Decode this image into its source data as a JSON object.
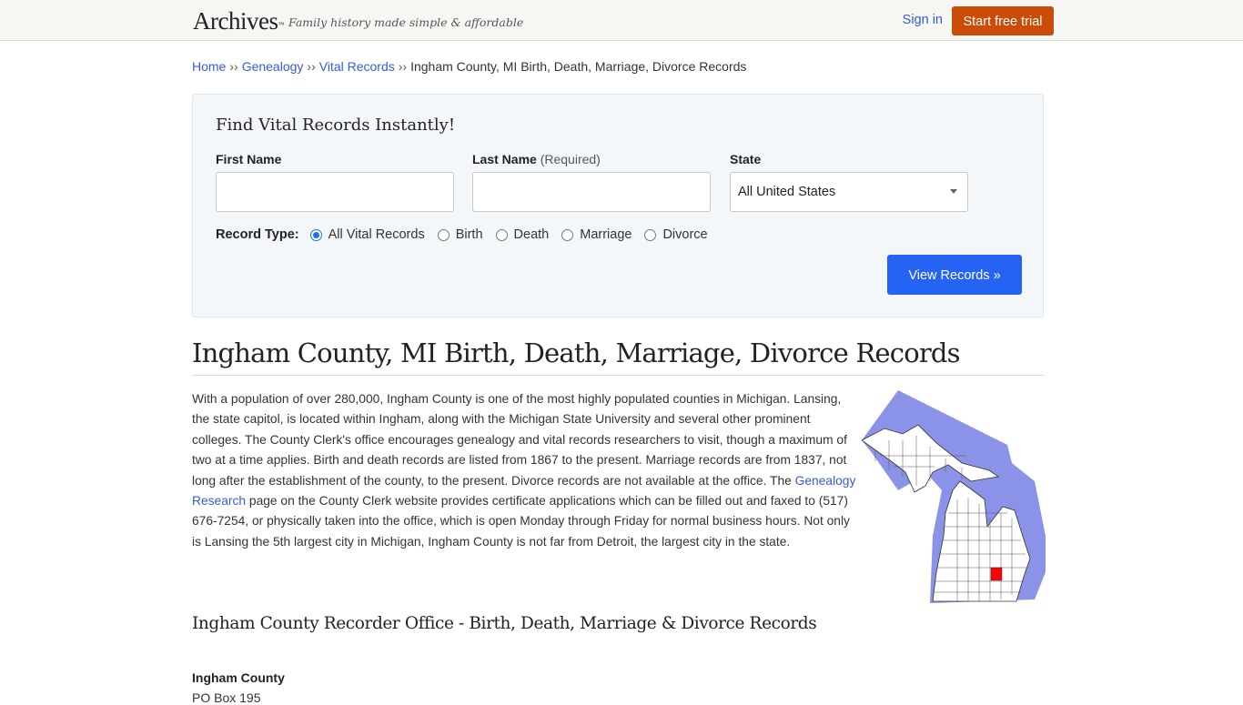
{
  "header": {
    "logo": "Archives",
    "logo_mark": "™",
    "tagline": "Family history made simple & affordable",
    "sign_in": "Sign in",
    "start_trial": "Start free trial"
  },
  "breadcrumb": {
    "items": [
      "Home",
      "Genealogy",
      "Vital Records"
    ],
    "separator": "››",
    "current": "Ingham County, MI Birth, Death, Marriage, Divorce Records"
  },
  "search": {
    "title": "Find Vital Records Instantly!",
    "first_name_label": "First Name",
    "first_name_value": "",
    "last_name_label": "Last Name",
    "last_name_required": "(Required)",
    "last_name_value": "",
    "state_label": "State",
    "state_value": "All United States",
    "record_type_label": "Record Type:",
    "record_types": [
      "All Vital Records",
      "Birth",
      "Death",
      "Marriage",
      "Divorce"
    ],
    "record_type_selected": "All Vital Records",
    "submit": "View Records »"
  },
  "main": {
    "title": "Ingham County, MI Birth, Death, Marriage, Divorce Records",
    "intro_part1": "With a population of over 280,000, Ingham County is one of the most highly populated counties in Michigan. Lansing, the state capitol, is located within Ingham, along with the Michigan State University and several other prominent colleges. The County Clerk's office encourages genealogy and vital records researchers to visit, though a maximum of two at a time applies. Birth and death records are listed from 1867 to the present. Marriage records are from 1837, not long after the establishment of the county, to the present. Divorce records are not available at the office. The ",
    "intro_link": "Genealogy Research",
    "intro_part2": " page on the County Clerk website provides certificate applications which can be filled out and faxed to (517) 676-7254, or physically taken into the office, which is open Monday through Friday for normal business hours. Not only is Lansing the 5th largest city in Michigan, Ingham County is not far from Detroit, the largest city in the state.",
    "map_alt": "Map of Michigan highlighting Ingham County",
    "map_colors": {
      "water": "#8b93e8",
      "land": "#ffffff",
      "highlight": "#ff0000",
      "border": "#333333"
    },
    "office_section_title": "Ingham County Recorder Office - Birth, Death, Marriage & Divorce Records",
    "office_name": "Ingham County",
    "office_address_line1": "PO Box 195"
  }
}
